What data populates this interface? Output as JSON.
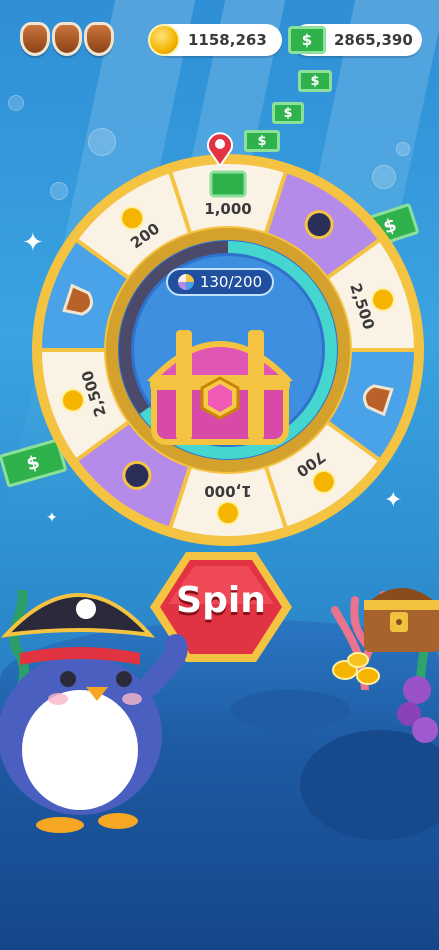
{
  "hud": {
    "shields": [
      "shield-icon",
      "shield-icon",
      "shield-icon"
    ],
    "coins": "1158,263",
    "cash": "2865,390"
  },
  "wheel": {
    "progress": "130/200",
    "progress_fraction": 0.65,
    "button_label": "Spin",
    "segments": [
      {
        "type": "cash",
        "label": "1,000",
        "icon": "cash-icon",
        "color": "#fbf2e6"
      },
      {
        "type": "bomb",
        "label": "",
        "icon": "bomb-icon",
        "color": "#b58bea"
      },
      {
        "type": "coins",
        "label": "2,500",
        "icon": "coin-icon",
        "color": "#fbf2e6"
      },
      {
        "type": "shield",
        "label": "",
        "icon": "shield-icon",
        "color": "#4aa2e8"
      },
      {
        "type": "coins",
        "label": "700",
        "icon": "coin-icon",
        "color": "#fbf2e6"
      },
      {
        "type": "coins",
        "label": "1,000",
        "icon": "coin-icon",
        "color": "#fbf2e6"
      },
      {
        "type": "bomb",
        "label": "",
        "icon": "bomb-icon",
        "color": "#b58bea"
      },
      {
        "type": "coins",
        "label": "2,500",
        "icon": "coin-icon",
        "color": "#fbf2e6"
      },
      {
        "type": "shield",
        "label": "",
        "icon": "shield-icon",
        "color": "#4aa2e8"
      },
      {
        "type": "coins",
        "label": "200",
        "icon": "coin-icon",
        "color": "#fbf2e6"
      }
    ]
  },
  "colors": {
    "accent_red": "#e23343",
    "gold": "#f5c342",
    "cash_green": "#2fb24c"
  }
}
